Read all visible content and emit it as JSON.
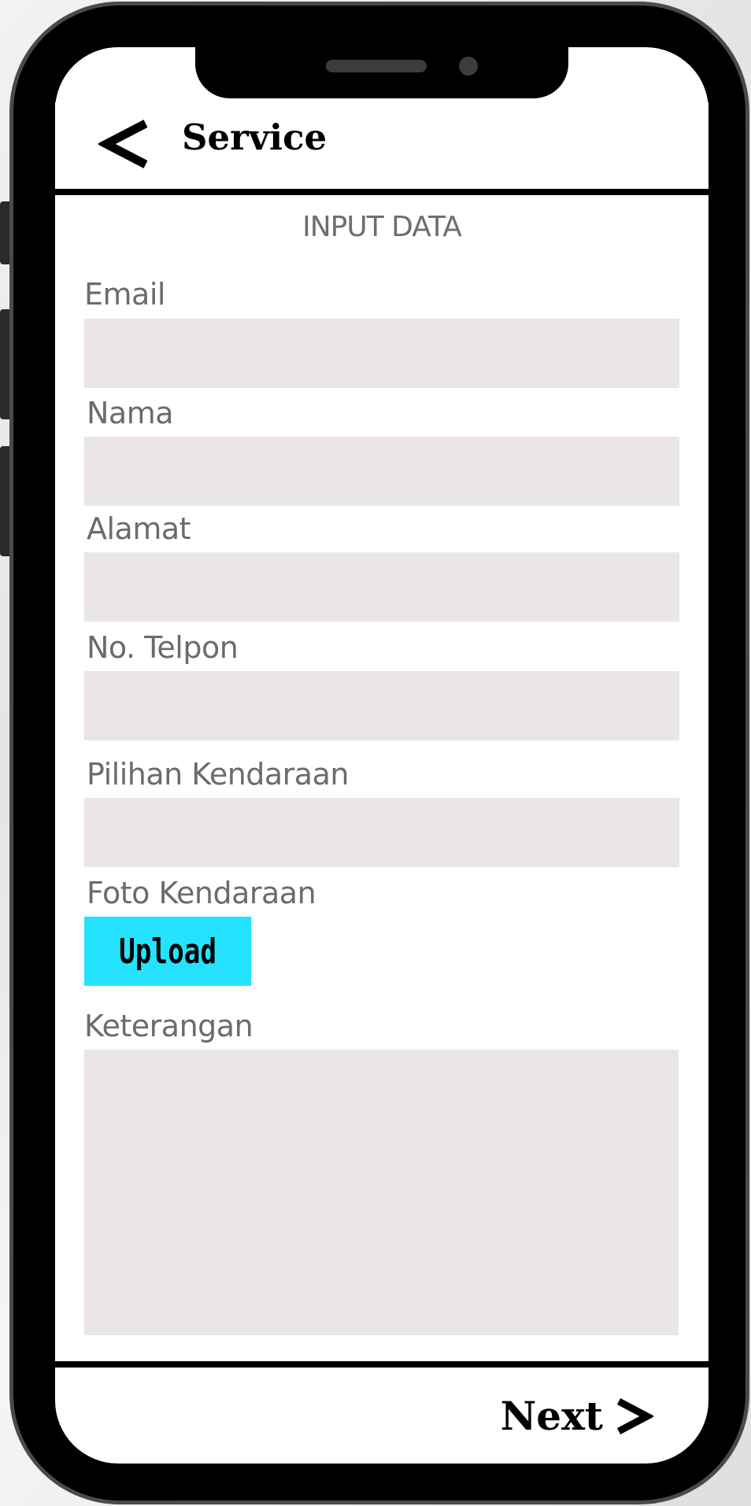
{
  "header": {
    "title": "Service",
    "back_icon": "chevron-left-icon"
  },
  "form": {
    "section_title": "INPUT DATA",
    "fields": [
      {
        "label": "Email",
        "value": ""
      },
      {
        "label": "Nama",
        "value": ""
      },
      {
        "label": "Alamat",
        "value": ""
      },
      {
        "label": "No. Telpon",
        "value": ""
      },
      {
        "label": "Pilihan Kendaraan",
        "value": ""
      }
    ],
    "photo": {
      "label": "Foto Kendaraan",
      "button_label": "Upload"
    },
    "notes": {
      "label": "Keterangan",
      "value": ""
    }
  },
  "footer": {
    "next_label": "Next",
    "next_icon": "chevron-right-icon"
  },
  "colors": {
    "accent": "#25E2FF",
    "input_bg": "#E9E6E5",
    "label_text": "#6B6B6B",
    "frame": "#000000"
  }
}
